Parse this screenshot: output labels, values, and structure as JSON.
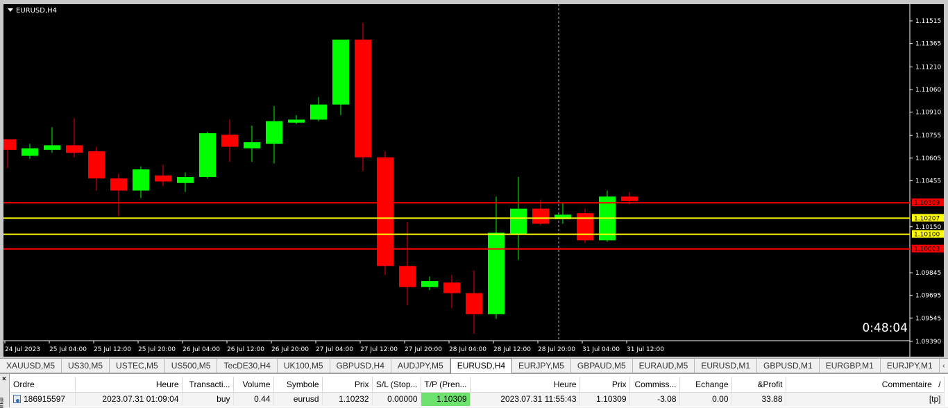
{
  "chart": {
    "title": "EURUSD,H4",
    "timer": "0:48:04",
    "price_labels": [
      "1.11515",
      "1.11365",
      "1.11210",
      "1.11060",
      "1.10910",
      "1.10755",
      "1.10605",
      "1.10455",
      "1.10150",
      "1.09845",
      "1.09695",
      "1.09545",
      "1.09390"
    ],
    "time_labels": [
      "24 Jul 2023",
      "25 Jul 04:00",
      "25 Jul 12:00",
      "25 Jul 20:00",
      "26 Jul 04:00",
      "26 Jul 12:00",
      "26 Jul 20:00",
      "27 Jul 04:00",
      "27 Jul 12:00",
      "27 Jul 20:00",
      "28 Jul 04:00",
      "28 Jul 12:00",
      "28 Jul 20:00",
      "31 Jul 04:00",
      "31 Jul 12:00"
    ],
    "levels": [
      {
        "value": "1.10309",
        "color": "#ff0000",
        "label_bg": "#ff0000",
        "label_fg": "#000000"
      },
      {
        "value": "1.10207",
        "color": "#ffff00",
        "label_bg": "#ffff00",
        "label_fg": "#000000"
      },
      {
        "value": "1.10100",
        "color": "#ffff00",
        "label_bg": "#ffff00",
        "label_fg": "#000000"
      },
      {
        "value": "1.10003",
        "color": "#ff0000",
        "label_bg": "#ff0000",
        "label_fg": "#000000"
      }
    ],
    "bull_color": "#00ff00",
    "bear_color": "#ff0000"
  },
  "chart_data": {
    "type": "candlestick",
    "symbol": "EURUSD",
    "timeframe": "H4",
    "candles": [
      {
        "o": 1.1073,
        "h": 1.1073,
        "l": 1.1054,
        "c": 1.1066
      },
      {
        "o": 1.1062,
        "h": 1.107,
        "l": 1.106,
        "c": 1.1067
      },
      {
        "o": 1.1066,
        "h": 1.1081,
        "l": 1.1064,
        "c": 1.1069
      },
      {
        "o": 1.1069,
        "h": 1.1087,
        "l": 1.1061,
        "c": 1.1064
      },
      {
        "o": 1.1065,
        "h": 1.1068,
        "l": 1.1039,
        "c": 1.1047
      },
      {
        "o": 1.1047,
        "h": 1.105,
        "l": 1.1022,
        "c": 1.1039
      },
      {
        "o": 1.1039,
        "h": 1.1055,
        "l": 1.1034,
        "c": 1.1053
      },
      {
        "o": 1.1049,
        "h": 1.1056,
        "l": 1.1042,
        "c": 1.1045
      },
      {
        "o": 1.1044,
        "h": 1.1051,
        "l": 1.1038,
        "c": 1.1048
      },
      {
        "o": 1.1048,
        "h": 1.1078,
        "l": 1.1047,
        "c": 1.1077
      },
      {
        "o": 1.1076,
        "h": 1.1086,
        "l": 1.1058,
        "c": 1.1068
      },
      {
        "o": 1.1067,
        "h": 1.1082,
        "l": 1.1058,
        "c": 1.1071
      },
      {
        "o": 1.107,
        "h": 1.1095,
        "l": 1.1057,
        "c": 1.1085
      },
      {
        "o": 1.1084,
        "h": 1.1089,
        "l": 1.1083,
        "c": 1.1086
      },
      {
        "o": 1.1086,
        "h": 1.1101,
        "l": 1.1085,
        "c": 1.1096
      },
      {
        "o": 1.1096,
        "h": 1.1131,
        "l": 1.1089,
        "c": 1.1139
      },
      {
        "o": 1.1139,
        "h": 1.115,
        "l": 1.1052,
        "c": 1.1061
      },
      {
        "o": 1.1061,
        "h": 1.1065,
        "l": 1.0983,
        "c": 1.0989
      },
      {
        "o": 1.0989,
        "h": 1.1018,
        "l": 1.0963,
        "c": 1.0975
      },
      {
        "o": 1.0975,
        "h": 1.0982,
        "l": 1.0973,
        "c": 1.0979
      },
      {
        "o": 1.0978,
        "h": 1.0983,
        "l": 1.0961,
        "c": 1.0971
      },
      {
        "o": 1.0971,
        "h": 1.0986,
        "l": 1.0944,
        "c": 1.0957
      },
      {
        "o": 1.0957,
        "h": 1.1035,
        "l": 1.0954,
        "c": 1.1011
      },
      {
        "o": 1.101,
        "h": 1.1048,
        "l": 1.0993,
        "c": 1.1027
      },
      {
        "o": 1.1027,
        "h": 1.1033,
        "l": 1.1016,
        "c": 1.1017
      },
      {
        "o": 1.102,
        "h": 1.1031,
        "l": 1.1017,
        "c": 1.1023
      },
      {
        "o": 1.1024,
        "h": 1.1027,
        "l": 1.1004,
        "c": 1.1006
      },
      {
        "o": 1.1006,
        "h": 1.1039,
        "l": 1.1005,
        "c": 1.1035
      },
      {
        "o": 1.1035,
        "h": 1.1038,
        "l": 1.103,
        "c": 1.1032
      }
    ],
    "ylim": [
      1.0939,
      1.1156
    ],
    "levels": [
      1.10309,
      1.10207,
      1.101,
      1.10003
    ]
  },
  "tabs": {
    "items": [
      "XAUUSD,M5",
      "US30,M5",
      "USTEC,M5",
      "US500,M5",
      "TecDE30,H4",
      "UK100,M5",
      "GBPUSD,H4",
      "AUDJPY,M5",
      "EURUSD,H4",
      "EURJPY,M5",
      "GBPAUD,M5",
      "EURAUD,M5",
      "EURUSD,M1",
      "GBPUSD,M1",
      "EURGBP,M1",
      "EURJPY,M1"
    ],
    "active": "EURUSD,H4",
    "nav_right": "‹"
  },
  "terminal": {
    "side_label": "inal",
    "close_glyph": "×",
    "headers": [
      "Ordre",
      "Heure",
      "Transacti...",
      "Volume",
      "Symbole",
      "Prix",
      "S/L (Stop...",
      "T/P (Pren...",
      "Heure",
      "Prix",
      "Commiss...",
      "Echange",
      "&Profit",
      "Commentaire"
    ],
    "sort_glyph": "/",
    "rows": [
      {
        "ordre": "186915597",
        "heure": "2023.07.31 01:09:04",
        "transaction": "buy",
        "volume": "0.44",
        "symbole": "eurusd",
        "prix": "1.10232",
        "sl": "0.00000",
        "tp": "1.10309",
        "heure2": "2023.07.31 11:55:43",
        "prix2": "1.10309",
        "commission": "-3.08",
        "echange": "0.00",
        "profit": "33.88",
        "commentaire": "[tp]"
      }
    ]
  }
}
